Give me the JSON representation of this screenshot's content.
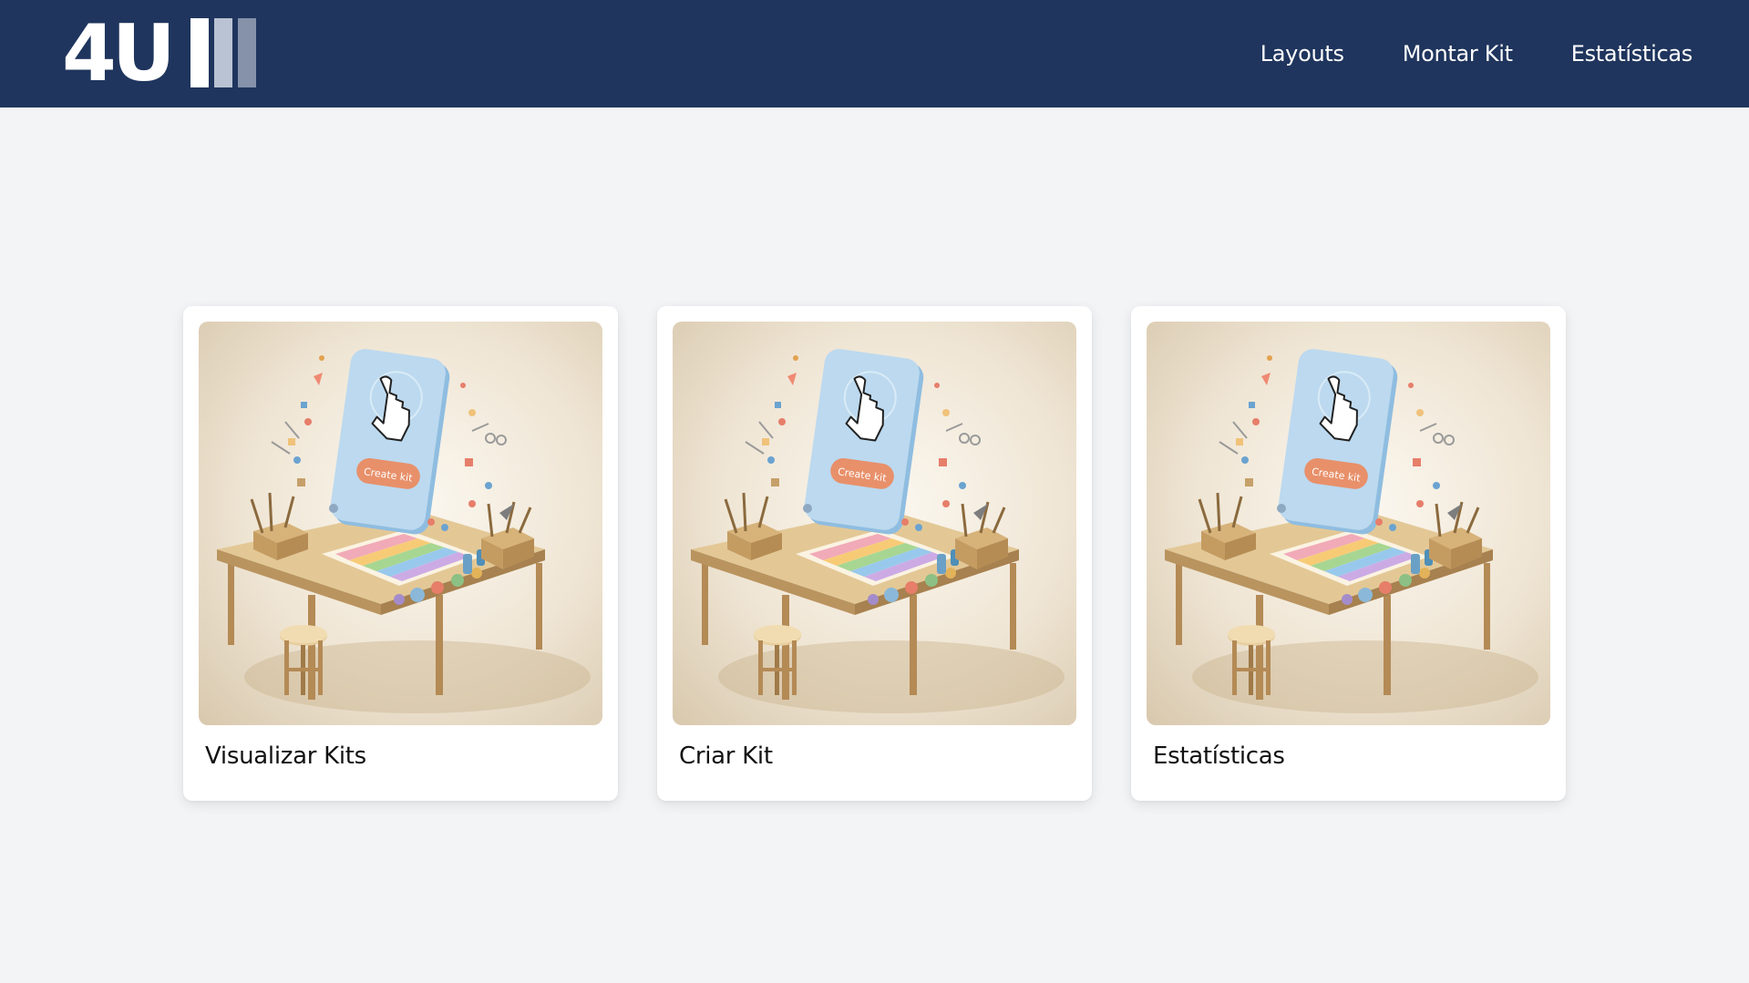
{
  "header": {
    "logo_text": "4U",
    "nav": [
      {
        "label": "Layouts"
      },
      {
        "label": "Montar Kit"
      },
      {
        "label": "Estatísticas"
      }
    ]
  },
  "illustration": {
    "button_text": "Create kit",
    "icon": "hand-pointer-icon"
  },
  "cards": [
    {
      "title": "Visualizar Kits"
    },
    {
      "title": "Criar Kit"
    },
    {
      "title": "Estatísticas"
    }
  ],
  "colors": {
    "header_bg": "#1f355d",
    "page_bg": "#f3f4f6",
    "card_bg": "#ffffff",
    "panel_blue": "#b9d8ef",
    "button_orange": "#e8906a"
  }
}
